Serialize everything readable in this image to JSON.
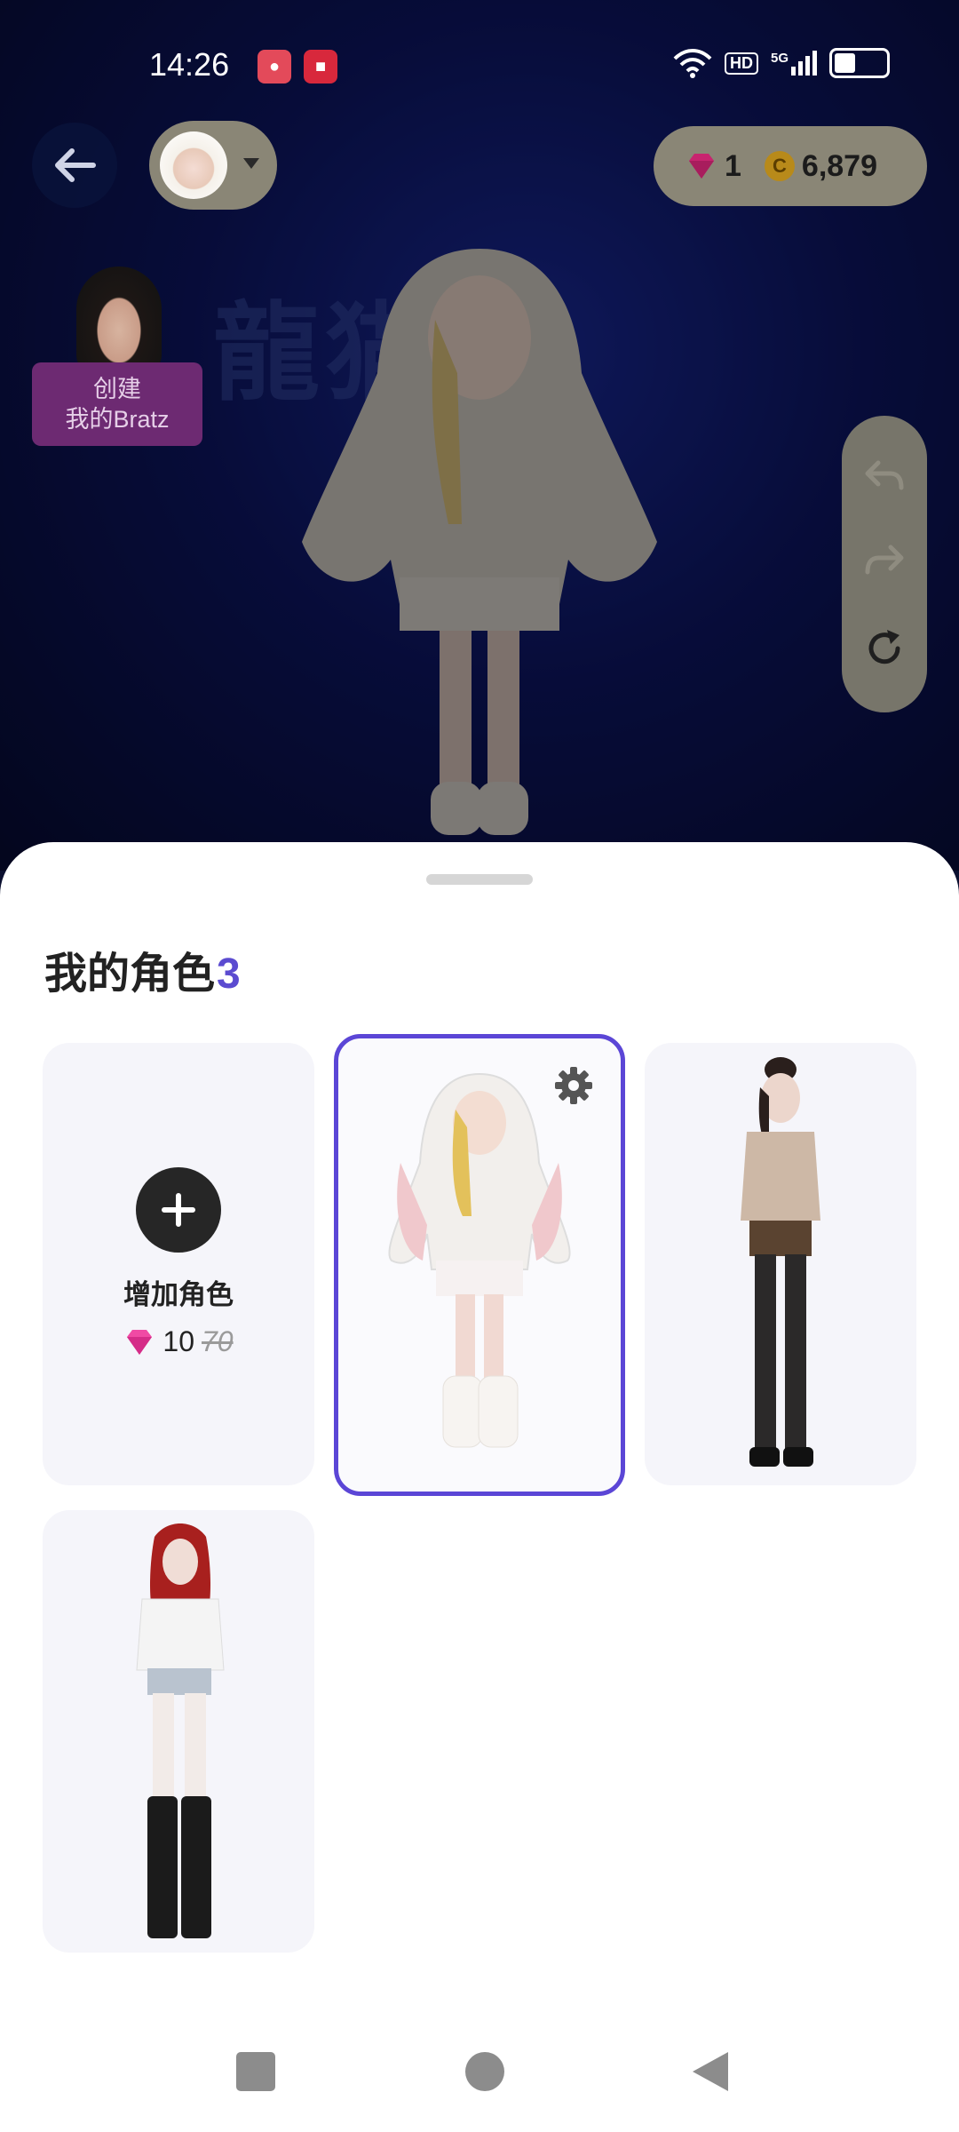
{
  "status_bar": {
    "time": "14:26",
    "network_badge": "HD",
    "network_type": "5G",
    "battery_level": 0.44
  },
  "header": {
    "back_icon": "arrow-left-icon",
    "currency": {
      "gems": "1",
      "coins": "6,879",
      "coin_symbol": "C"
    }
  },
  "promo": {
    "line1": "创建",
    "line2": "我的Bratz"
  },
  "scene": {
    "watermark": "龍猫 bi"
  },
  "sheet": {
    "title": "我的角色",
    "count": "3",
    "add_card": {
      "label": "增加角色",
      "price": "10",
      "old_price": "70"
    },
    "characters": [
      {
        "name": "bunny-hoodie-character",
        "selected": true
      },
      {
        "name": "lace-blouse-character",
        "selected": false
      },
      {
        "name": "red-hair-character",
        "selected": false
      }
    ]
  },
  "colors": {
    "accent": "#5b46d6",
    "gem": "#e8318f",
    "sheet_background": "#ffffff",
    "card_background": "#f5f5fa"
  }
}
